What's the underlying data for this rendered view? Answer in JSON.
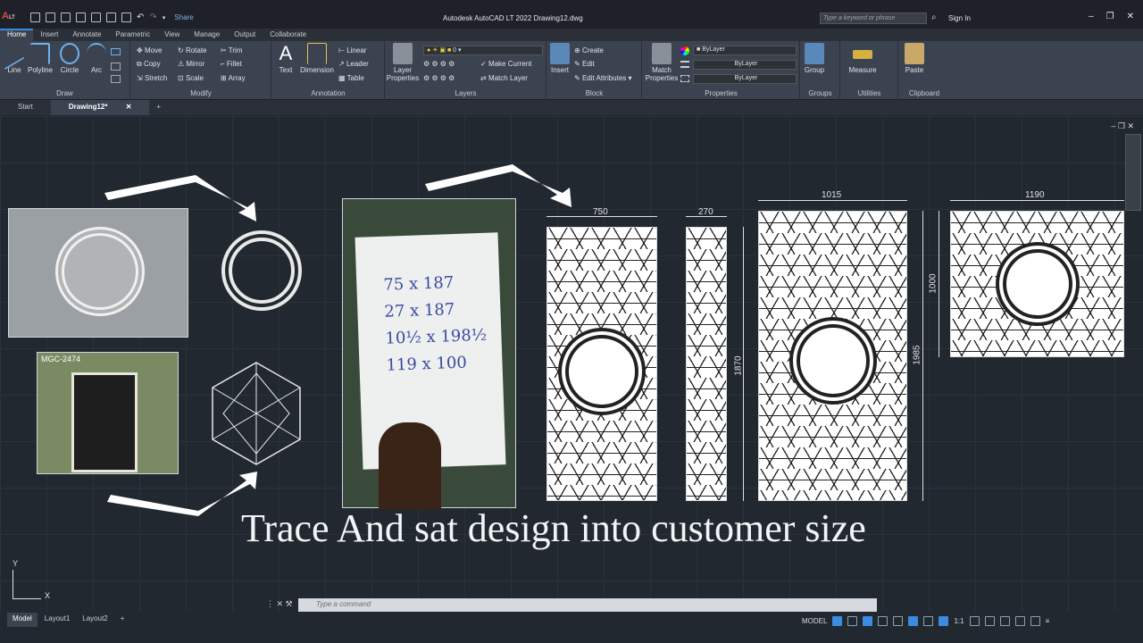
{
  "app": {
    "logo": "A",
    "logo_sub": "LT",
    "share_label": "Share",
    "window_title": "Autodesk AutoCAD LT 2022    Drawing12.dwg",
    "search_placeholder": "Type a keyword or phrase",
    "sign_in": "Sign In"
  },
  "ribbon_tabs": [
    "Home",
    "Insert",
    "Annotate",
    "Parametric",
    "View",
    "Manage",
    "Output",
    "Collaborate"
  ],
  "panels": {
    "draw": {
      "label": "Draw",
      "tools": [
        "Line",
        "Polyline",
        "Circle",
        "Arc"
      ]
    },
    "modify": {
      "label": "Modify",
      "tools": [
        "Move",
        "Rotate",
        "Trim",
        "Copy",
        "Mirror",
        "Fillet",
        "Stretch",
        "Scale",
        "Array"
      ]
    },
    "annotation": {
      "label": "Annotation",
      "big": [
        "Text",
        "Dimension"
      ],
      "small": [
        "Linear",
        "Leader",
        "Table"
      ]
    },
    "layers": {
      "label": "Layers",
      "big": "Layer Properties",
      "layer_value": "0",
      "small": [
        "Make Current",
        "Match Layer"
      ]
    },
    "block": {
      "label": "Block",
      "big": "Insert",
      "small": [
        "Create",
        "Edit",
        "Edit Attributes"
      ]
    },
    "properties": {
      "label": "Properties",
      "big": "Match Properties",
      "combos": [
        "ByLayer",
        "ByLayer",
        "ByLayer"
      ]
    },
    "groups": {
      "label": "Groups",
      "big": "Group"
    },
    "utilities": {
      "label": "Utilities",
      "big": "Measure"
    },
    "clipboard": {
      "label": "Clipboard",
      "big": "Paste"
    }
  },
  "doc_tabs": [
    "Start",
    "Drawing12*"
  ],
  "drawing": {
    "dims": {
      "w1": "750",
      "w2": "270",
      "w3": "1015",
      "w4": "1190",
      "h1": "1870",
      "h2": "1985",
      "h3": "1000"
    },
    "photo_label": "MGC-2474",
    "note_lines": [
      "75 x 187",
      "27 x 187",
      "10½ x 198½",
      "119 x 100"
    ],
    "caption": "Trace And sat design into customer size"
  },
  "command_placeholder": "Type a command",
  "layout_tabs": [
    "Model",
    "Layout1",
    "Layout2"
  ],
  "status": {
    "model": "MODEL",
    "scale": "1:1"
  },
  "ucs": {
    "y": "Y",
    "x": "X"
  }
}
